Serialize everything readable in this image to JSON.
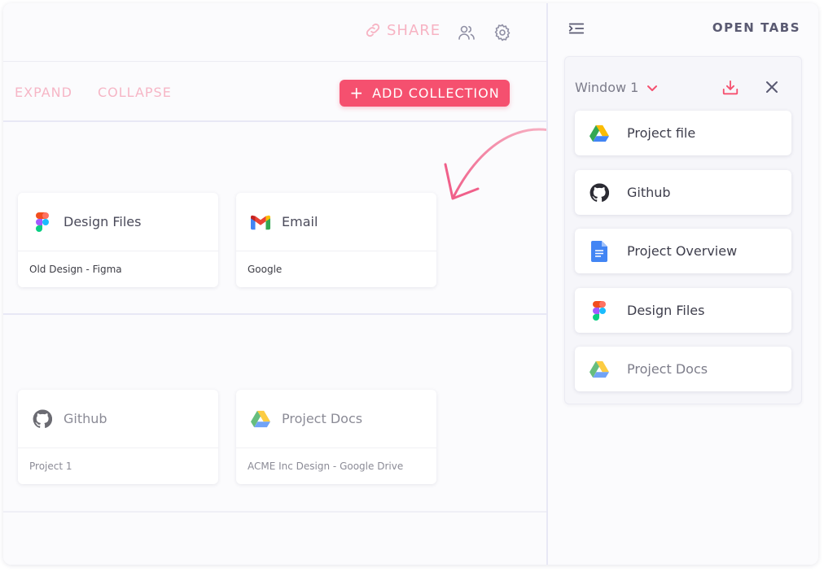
{
  "header": {
    "share_label": "SHARE"
  },
  "actions": {
    "expand_label": "EXPAND",
    "collapse_label": "COLLAPSE",
    "add_collection_label": "ADD COLLECTION",
    "add_icon": "+"
  },
  "collections": [
    {
      "cards": [
        {
          "title": "Design Files",
          "subtitle": "Old Design - Figma",
          "icon": "figma-icon"
        },
        {
          "title": "Email",
          "subtitle": "Google",
          "icon": "gmail-icon"
        }
      ]
    },
    {
      "cards": [
        {
          "title": "Github",
          "subtitle": "Project 1",
          "icon": "github-icon"
        },
        {
          "title": "Project Docs",
          "subtitle": "ACME Inc Design - Google Drive",
          "icon": "google-drive-icon"
        }
      ]
    }
  ],
  "panel": {
    "title": "OPEN TABS",
    "window_label": "Window 1",
    "tabs": [
      {
        "label": "Project file",
        "icon": "google-drive-icon"
      },
      {
        "label": "Github",
        "icon": "github-icon"
      },
      {
        "label": "Project Overview",
        "icon": "google-docs-icon"
      },
      {
        "label": "Design Files",
        "icon": "figma-icon"
      },
      {
        "label": "Project Docs",
        "icon": "google-drive-icon"
      }
    ]
  },
  "colors": {
    "accent": "#f5506f",
    "accent_light": "#f6b6c6",
    "text": "#4a4a5a",
    "panel_title": "#5a5a72"
  }
}
